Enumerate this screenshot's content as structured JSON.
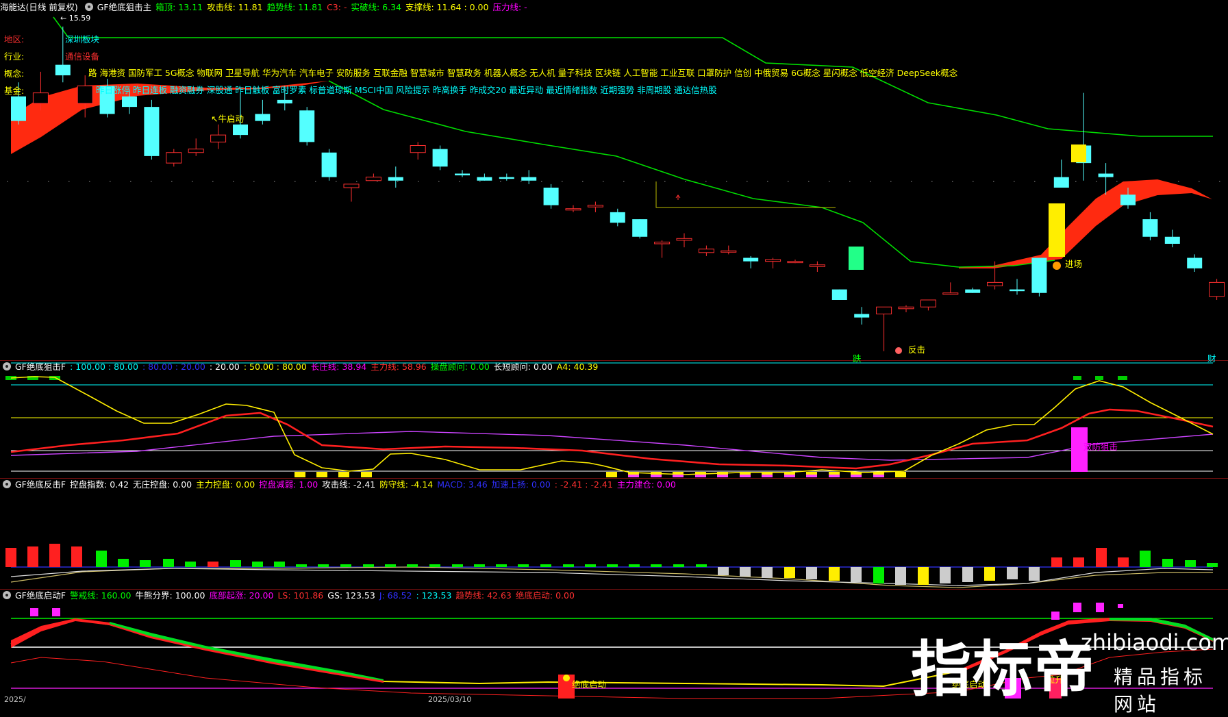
{
  "panel1": {
    "title_name": "海能达(日线 前复权)",
    "indicator": "GF绝底狙击主",
    "params": [
      {
        "label": "箱顶: 13.11",
        "color": "#00ff00"
      },
      {
        "label": "攻击线: 11.81",
        "color": "#ffff00"
      },
      {
        "label": "趋势线: 11.81",
        "color": "#00ff00"
      },
      {
        "label": "C3: -",
        "color": "#ff3030"
      },
      {
        "label": "实破线: 6.34",
        "color": "#00ff00"
      },
      {
        "label": "支撑线: 11.64 : 0.00",
        "color": "#ffff00"
      },
      {
        "label": "压力线: -",
        "color": "#ff00ff"
      }
    ],
    "high_label": "15.59",
    "side_labels": {
      "region": "地区:",
      "industry": "行业:",
      "concept": "概念:",
      "fund": "基金:"
    },
    "region_value": "深圳板块",
    "industry_value": "通信设备",
    "concepts_line1": "路 海港资 国防军工 5G概念 物联网 卫星导航 华为汽车 汽车电子 安防服务 互联金融 智慧城市 智慧政务 机器人概念 无人机 量子科技 区块链 人工智能 工业互联 口罩防护 信创 中俄贸易 6G概念 星闪概念 低空经济 DeepSeek概念",
    "concepts_line2": "昨日涨停 昨日连板 融资融券 深股通 昨日触板 富时罗素 标普道琼斯 MSCI中国 风险提示 昨高换手 昨成交20 最近异动 最近情绪指数 近期强势 非周期股 通达信热股",
    "ann_niu": "牛启动",
    "ann_jinchang": "进场",
    "ann_fanji": "反击",
    "ann_die": "跌",
    "ann_cai": "财"
  },
  "panel2": {
    "indicator": "GF绝底狙击F",
    "params": [
      {
        "label": ": 100.00 : 80.00",
        "color": "#00ffff"
      },
      {
        "label": ": 80.00 : 20.00",
        "color": "#3030ff"
      },
      {
        "label": ": 20.00",
        "color": "#ffffff"
      },
      {
        "label": ": 50.00 : 80.00",
        "color": "#ffff00"
      },
      {
        "label": "长庄线: 38.94",
        "color": "#ff00ff"
      },
      {
        "label": "主力线: 58.96",
        "color": "#ff3030"
      },
      {
        "label": "操盘顾问: 0.00",
        "color": "#00ff00"
      },
      {
        "label": "长短顾问: 0.00",
        "color": "#ffffff"
      },
      {
        "label": "A4: 40.39",
        "color": "#ffff00"
      }
    ],
    "ann": "双防狙击"
  },
  "panel3": {
    "indicator": "GF绝底反击F",
    "params": [
      {
        "label": "控盘指数: 0.42",
        "color": "#ffffff"
      },
      {
        "label": "无庄控盘: 0.00",
        "color": "#ffffff"
      },
      {
        "label": "主力控盘: 0.00",
        "color": "#ffff00"
      },
      {
        "label": "控盘减弱: 1.00",
        "color": "#ff00ff"
      },
      {
        "label": "攻击线: -2.41",
        "color": "#ffffff"
      },
      {
        "label": "防守线: -4.14",
        "color": "#ffff00"
      },
      {
        "label": "MACD: 3.46",
        "color": "#3030ff"
      },
      {
        "label": "加速上扬: 0.00",
        "color": "#3030ff"
      },
      {
        "label": ": -2.41 : -2.41",
        "color": "#ff3030"
      },
      {
        "label": "主力建仓: 0.00",
        "color": "#ff00ff"
      }
    ]
  },
  "panel4": {
    "indicator": "GF绝底启动F",
    "params": [
      {
        "label": "警戒线: 160.00",
        "color": "#00ff00"
      },
      {
        "label": "牛熊分界: 100.00",
        "color": "#ffffff"
      },
      {
        "label": "底部起涨: 20.00",
        "color": "#ff00ff"
      },
      {
        "label": "LS: 101.86",
        "color": "#ff3030"
      },
      {
        "label": "GS: 123.53",
        "color": "#ffffff"
      },
      {
        "label": "J: 68.52",
        "color": "#3030ff"
      },
      {
        "label": ": 123.53",
        "color": "#00ffff"
      },
      {
        "label": "趋势线: 42.63",
        "color": "#ff3030"
      },
      {
        "label": "绝底启动: 0.00",
        "color": "#ff3030"
      }
    ],
    "ann_qidong": "绝底启动",
    "ann_qidong2": "绝底启动",
    "ann_lashen": "拉升"
  },
  "watermark": {
    "brand": "指标帝",
    "domain": "zhibiaodi.com",
    "slogan": "精品指标网站"
  },
  "bottom_labels": {
    "left": "2025/",
    "mid": "2025/03/10"
  },
  "chart_data": {
    "type": "candlestick",
    "title": "海能达(日线 前复权)",
    "high_marker": 15.59,
    "ohlc": [
      [
        13.6,
        14.0,
        12.8,
        12.9
      ],
      [
        13.4,
        14.3,
        13.2,
        13.7
      ],
      [
        14.5,
        15.59,
        14.0,
        14.2
      ],
      [
        13.4,
        14.2,
        13.0,
        13.9
      ],
      [
        13.9,
        14.1,
        13.0,
        13.1
      ],
      [
        13.6,
        13.8,
        13.1,
        13.3
      ],
      [
        13.3,
        13.5,
        11.8,
        11.9
      ],
      [
        11.7,
        12.1,
        11.6,
        12.0
      ],
      [
        12.0,
        12.4,
        11.9,
        12.1
      ],
      [
        12.3,
        12.8,
        12.1,
        12.5
      ],
      [
        12.8,
        13.7,
        12.4,
        12.5
      ],
      [
        13.1,
        13.5,
        12.8,
        12.9
      ],
      [
        13.5,
        13.9,
        13.2,
        13.4
      ],
      [
        13.2,
        13.3,
        12.2,
        12.3
      ],
      [
        12.0,
        12.1,
        11.2,
        11.3
      ],
      [
        11.0,
        11.1,
        10.6,
        11.1
      ],
      [
        11.2,
        11.4,
        11.2,
        11.3
      ],
      [
        11.3,
        11.6,
        11.0,
        11.2
      ],
      [
        12.0,
        12.3,
        11.8,
        12.2
      ],
      [
        12.1,
        12.2,
        11.5,
        11.6
      ],
      [
        11.4,
        11.5,
        11.3,
        11.35
      ],
      [
        11.3,
        11.4,
        11.2,
        11.2
      ],
      [
        11.3,
        11.4,
        11.2,
        11.25
      ],
      [
        11.3,
        11.5,
        11.1,
        11.2
      ],
      [
        11.0,
        11.1,
        10.4,
        10.5
      ],
      [
        10.4,
        10.5,
        10.3,
        10.4
      ],
      [
        10.45,
        10.6,
        10.3,
        10.5
      ],
      [
        10.3,
        10.4,
        9.9,
        10.0
      ],
      [
        10.1,
        10.1,
        9.55,
        9.6
      ],
      [
        9.4,
        9.5,
        9.0,
        9.45
      ],
      [
        9.5,
        9.7,
        9.3,
        9.55
      ],
      [
        9.15,
        9.35,
        9.05,
        9.25
      ],
      [
        9.2,
        9.35,
        9.1,
        9.2
      ],
      [
        9.0,
        9.05,
        8.7,
        8.9
      ],
      [
        8.9,
        9.0,
        8.7,
        8.95
      ],
      [
        8.9,
        8.95,
        8.85,
        8.9
      ],
      [
        8.75,
        8.9,
        8.6,
        8.8
      ],
      [
        8.1,
        8.1,
        7.8,
        7.8
      ],
      [
        7.4,
        7.6,
        7.1,
        7.3
      ],
      [
        7.4,
        7.6,
        6.34,
        7.6
      ],
      [
        7.55,
        7.65,
        7.45,
        7.6
      ],
      [
        7.6,
        7.8,
        7.5,
        7.8
      ],
      [
        8.0,
        8.3,
        7.95,
        8.0
      ],
      [
        8.1,
        8.15,
        8.0,
        8.0
      ],
      [
        8.2,
        8.9,
        8.1,
        8.3
      ],
      [
        8.1,
        8.4,
        7.95,
        8.05
      ],
      [
        9.0,
        9.0,
        7.9,
        8.0
      ],
      [
        11.3,
        11.8,
        11.0,
        11.0
      ],
      [
        12.2,
        13.7,
        11.2,
        11.7
      ],
      [
        11.4,
        11.7,
        10.8,
        11.3
      ],
      [
        10.8,
        11.0,
        10.4,
        10.5
      ],
      [
        10.1,
        10.3,
        9.5,
        9.6
      ],
      [
        9.6,
        9.8,
        9.3,
        9.4
      ],
      [
        9.0,
        9.1,
        8.6,
        8.7
      ],
      [
        7.9,
        8.4,
        7.8,
        8.3
      ]
    ],
    "series": [
      {
        "name": "趋势线",
        "color": "#00ff00"
      },
      {
        "name": "长庄线",
        "color": "#ff00ff"
      },
      {
        "name": "主力线",
        "color": "#ff3030"
      },
      {
        "name": "A4",
        "color": "#ffff00"
      }
    ]
  }
}
